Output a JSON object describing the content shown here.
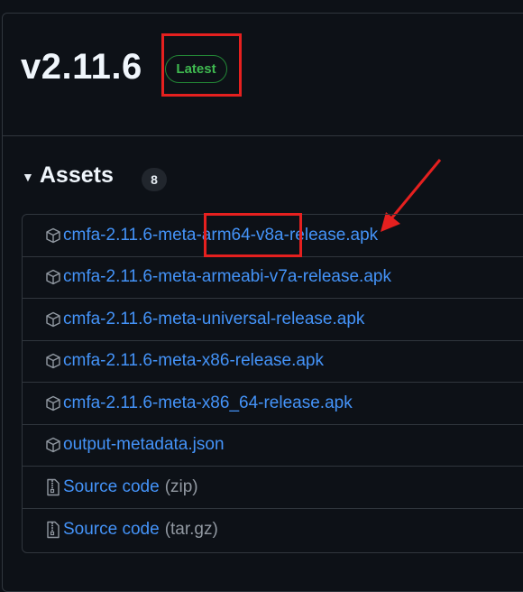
{
  "release": {
    "version": "v2.11.6",
    "badge": "Latest"
  },
  "assets": {
    "title": "Assets",
    "count": "8",
    "items": [
      {
        "name": "cmfa-2.11.6-meta-arm64-v8a-release.apk",
        "icon": "package-icon"
      },
      {
        "name": "cmfa-2.11.6-meta-armeabi-v7a-release.apk",
        "icon": "package-icon"
      },
      {
        "name": "cmfa-2.11.6-meta-universal-release.apk",
        "icon": "package-icon"
      },
      {
        "name": "cmfa-2.11.6-meta-x86-release.apk",
        "icon": "package-icon"
      },
      {
        "name": "cmfa-2.11.6-meta-x86_64-release.apk",
        "icon": "package-icon"
      },
      {
        "name": "output-metadata.json",
        "icon": "package-icon"
      },
      {
        "name": "Source code",
        "suffix": "(zip)",
        "icon": "file-zip-icon"
      },
      {
        "name": "Source code",
        "suffix": "(tar.gz)",
        "icon": "file-zip-icon"
      }
    ]
  },
  "colors": {
    "background": "#0d1117",
    "link": "#4493f8",
    "badge_green": "#3fb950",
    "annotation_red": "#e5201f",
    "border": "#30363d"
  }
}
